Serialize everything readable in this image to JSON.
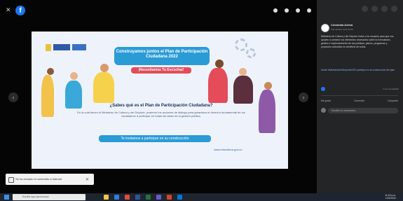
{
  "viewer": {
    "poster": {
      "headline": "Construyamos juntos el Plan de Participación Ciudadana 2022",
      "subheadline": "¡Necesitamos Tu Escuchar!",
      "question": "¿Sabes qué es el Plan de Participación Ciudadana?",
      "body": "En la cual tienen el Ministerio de Cultura y del Deporte, pusieron los acciones de diálogo para garantizar el derecho fundamental de los ciudadanos a participar en todas las fases de la gestión pública.",
      "invite": "Te invitamos a participar en su construcción",
      "url": "www.mincultura.gov.co"
    },
    "notification": "Se ha enviado el contenido a Internet"
  },
  "panel": {
    "page_name": "Colombia Activa",
    "post_date": "5 de febrero a las 11:00",
    "post_text": "Ministerio de Cultura y del Deporte invita a los usuarios para que nos ayuden a construir los elementos necesarios sobre la formulación, gestión e implementación de las políticas, planes, programas y proyectos culturales en beneficio de todos.",
    "hashtags": "Únete #MinisterioDeDeporte2022 participa en la construcción del plan",
    "shares": "1 vez compartido",
    "actions": [
      "Me gusta",
      "Comentar",
      "Compartir"
    ],
    "comment_placeholder": "Escribe un comentario..."
  },
  "taskbar": {
    "search_placeholder": "Escribe aquí para buscar",
    "time": "11:49 a.m.",
    "date": "1/02/2022"
  }
}
